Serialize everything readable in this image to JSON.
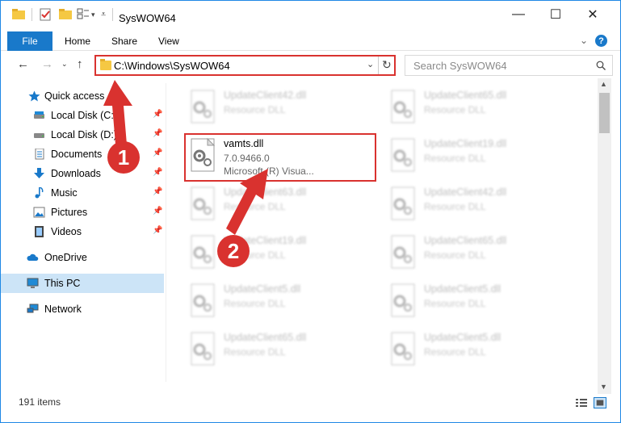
{
  "window": {
    "title": "SysWOW64",
    "minimize_glyph": "—",
    "maximize_glyph": "☐",
    "close_glyph": "✕"
  },
  "ribbon": {
    "tabs": [
      "File",
      "Home",
      "Share",
      "View"
    ],
    "help_glyph": "?"
  },
  "nav": {
    "address": "C:\\Windows\\SysWOW64",
    "search_placeholder": "Search SysWOW64"
  },
  "sidebar": {
    "items": [
      {
        "label": "Quick access",
        "icon": "star-icon",
        "pinned": false
      },
      {
        "label": "Local Disk (C:)",
        "icon": "drive-icon",
        "pinned": true
      },
      {
        "label": "Local Disk (D:)",
        "icon": "drive-icon",
        "pinned": true
      },
      {
        "label": "Documents",
        "icon": "documents-icon",
        "pinned": true
      },
      {
        "label": "Downloads",
        "icon": "download-icon",
        "pinned": true
      },
      {
        "label": "Music",
        "icon": "music-icon",
        "pinned": true
      },
      {
        "label": "Pictures",
        "icon": "pictures-icon",
        "pinned": true
      },
      {
        "label": "Videos",
        "icon": "videos-icon",
        "pinned": true
      },
      {
        "label": "OneDrive",
        "icon": "cloud-icon",
        "pinned": false
      },
      {
        "label": "This PC",
        "icon": "pc-icon",
        "pinned": false,
        "selected": true
      },
      {
        "label": "Network",
        "icon": "network-icon",
        "pinned": false
      }
    ]
  },
  "files": {
    "highlighted": {
      "name": "vamts.dll",
      "version": "7.0.9466.0",
      "company": "Microsoft (R) Visua..."
    },
    "left_column": [
      {
        "name": "UpdateClient42.dll",
        "type": "Resource DLL"
      },
      {
        "name": "UpdateClient63.dll",
        "type": "Resource DLL"
      },
      {
        "name": "UpdateClient19.dll",
        "type": "Resource DLL"
      },
      {
        "name": "UpdateClient5.dll",
        "type": "Resource DLL"
      },
      {
        "name": "UpdateClient65.dll",
        "type": "Resource DLL"
      }
    ],
    "right_column": [
      {
        "name": "UpdateClient65.dll",
        "type": "Resource DLL"
      },
      {
        "name": "UpdateClient19.dll",
        "type": "Resource DLL"
      },
      {
        "name": "UpdateClient42.dll",
        "type": "Resource DLL"
      },
      {
        "name": "UpdateClient65.dll",
        "type": "Resource DLL"
      },
      {
        "name": "UpdateClient5.dll",
        "type": "Resource DLL"
      },
      {
        "name": "UpdateClient5.dll",
        "type": "Resource DLL"
      }
    ]
  },
  "status": {
    "item_count": "191 items"
  },
  "callouts": {
    "one": "1",
    "two": "2"
  },
  "colors": {
    "accent": "#1979ca",
    "highlight": "#d9322f",
    "selected": "#cce4f7"
  }
}
